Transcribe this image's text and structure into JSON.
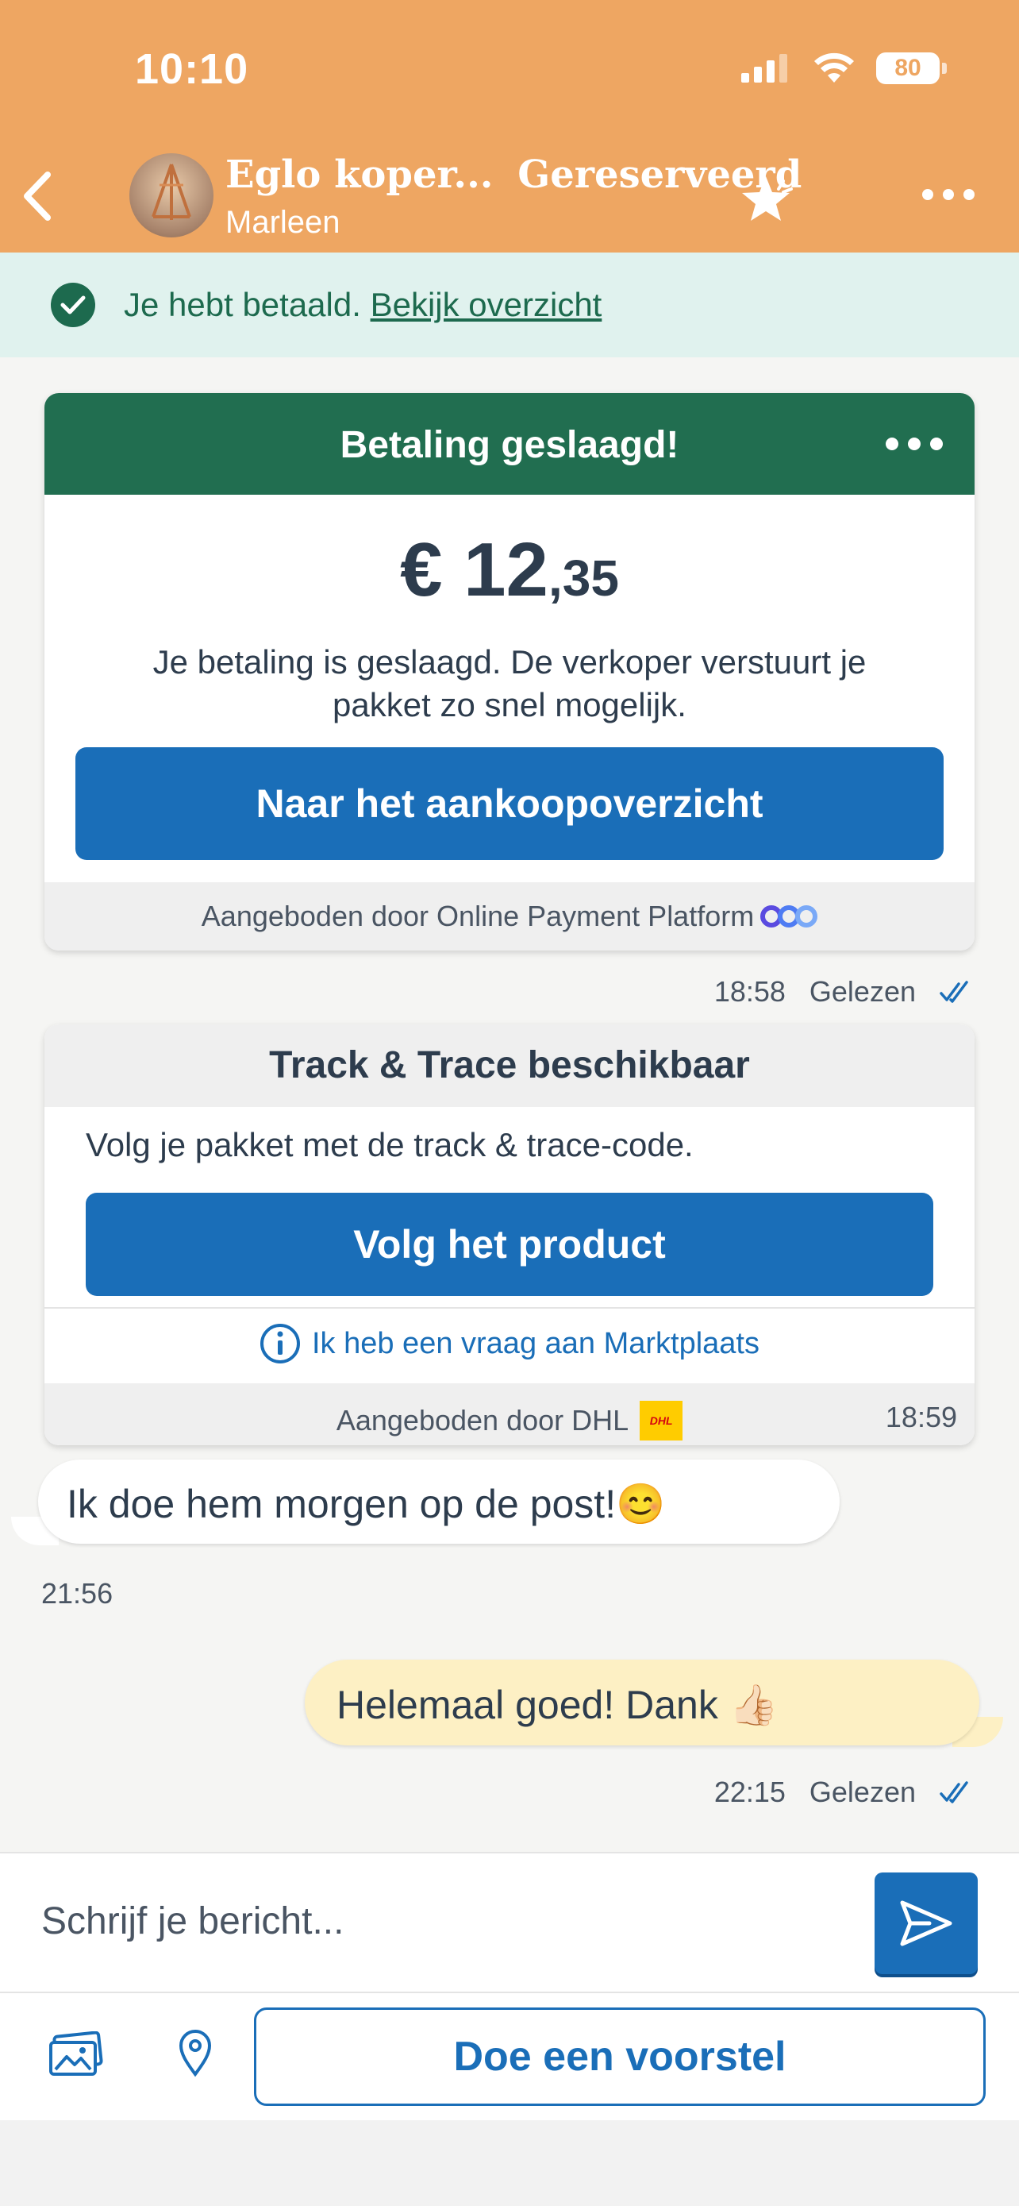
{
  "status_bar": {
    "time": "10:10",
    "battery": "80"
  },
  "header": {
    "title": "Eglo koper...",
    "status": "Gereserveerd",
    "subtitle": "Marleen"
  },
  "banner": {
    "text": "Je hebt betaald.",
    "link": "Bekijk overzicht"
  },
  "payment_card": {
    "title": "Betaling geslaagd!",
    "currency": "€",
    "amount_whole": "12",
    "amount_cents": ",35",
    "body": "Je betaling is geslaagd. De verkoper verstuurt je pakket zo snel mogelijk.",
    "button": "Naar het aankoopoverzicht",
    "footer": "Aangeboden door Online Payment Platform"
  },
  "payment_meta": {
    "time": "18:58",
    "status": "Gelezen"
  },
  "track_card": {
    "title": "Track & Trace beschikbaar",
    "body": "Volg je pakket met de track & trace-code.",
    "button": "Volg het product",
    "help": "Ik heb een vraag aan Marktplaats",
    "footer": "Aangeboden door DHL",
    "time": "18:59"
  },
  "messages": [
    {
      "direction": "in",
      "text": "Ik doe hem morgen op de post!😊",
      "time": "21:56"
    },
    {
      "direction": "out",
      "text": "Helemaal goed! Dank 👍🏻",
      "time": "22:15",
      "status": "Gelezen"
    }
  ],
  "composer": {
    "placeholder": "Schrijf je bericht..."
  },
  "toolbar": {
    "offer_button": "Doe een voorstel"
  },
  "colors": {
    "header": "#eea662",
    "accent_blue": "#1a6eb8",
    "success_green": "#216e50"
  },
  "icons": [
    "back-chevron-icon",
    "star-icon",
    "more-icon",
    "check-circle-icon",
    "read-checkmarks-icon",
    "info-icon",
    "send-icon",
    "photo-icon",
    "location-pin-icon"
  ]
}
